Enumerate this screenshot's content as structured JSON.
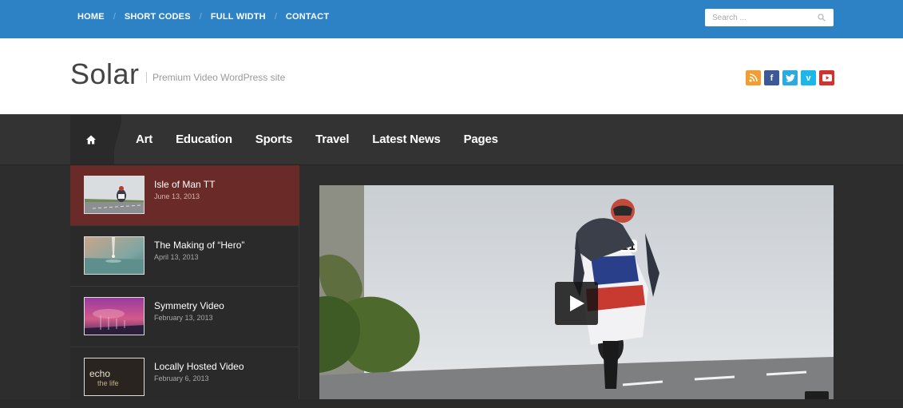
{
  "topnav": {
    "items": [
      "HOME",
      "SHORT CODES",
      "FULL WIDTH",
      "CONTACT"
    ],
    "search_placeholder": "Search ..."
  },
  "header": {
    "logo": "Solar",
    "tagline": "Premium Video WordPress site",
    "social": [
      {
        "name": "rss-icon",
        "color": "#f39c30"
      },
      {
        "name": "facebook-icon",
        "label": "f",
        "color": "#3b5998"
      },
      {
        "name": "twitter-icon",
        "color": "#2ba9e1"
      },
      {
        "name": "vimeo-icon",
        "label": "v",
        "color": "#1ab7ea"
      },
      {
        "name": "youtube-icon",
        "color": "#d2322d"
      }
    ]
  },
  "mainnav": {
    "items": [
      "Art",
      "Education",
      "Sports",
      "Travel",
      "Latest News",
      "Pages"
    ]
  },
  "videolist": [
    {
      "title": "Isle of Man TT",
      "date": "June 13, 2013",
      "active": true
    },
    {
      "title": "The Making of “Hero”",
      "date": "April 13, 2013",
      "active": false
    },
    {
      "title": "Symmetry Video",
      "date": "February 13, 2013",
      "active": false
    },
    {
      "title": "Locally Hosted Video",
      "date": "February 6, 2013",
      "active": false,
      "thumb_text": "echo",
      "thumb_subtext": "the life"
    }
  ],
  "colors": {
    "topbar": "#2c82c5",
    "active_item": "#6a2a27"
  }
}
